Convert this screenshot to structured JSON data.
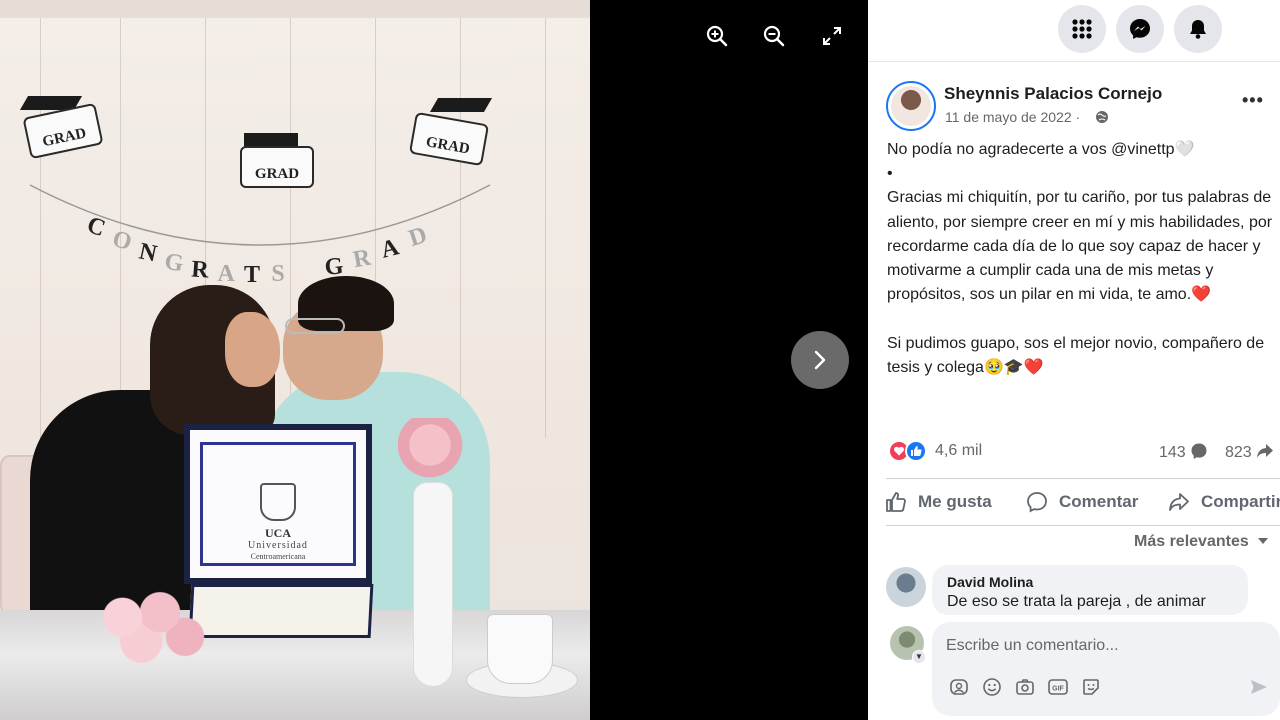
{
  "viewer": {
    "zoom_in_icon": "zoom-in-icon",
    "zoom_out_icon": "zoom-out-icon",
    "fullscreen_icon": "fullscreen-icon",
    "next_icon": "chevron-right-icon"
  },
  "photo": {
    "banner_signs": [
      "GRAD",
      "GRAD",
      "GRAD"
    ],
    "banner_letters": [
      "C",
      "O",
      "N",
      "G",
      "R",
      "A",
      "T",
      "S",
      "G",
      "R",
      "A",
      "D"
    ],
    "diploma": {
      "acronym": "UCA",
      "university": "Universidad",
      "university_line2": "Centroamericana"
    }
  },
  "topbar": {
    "menu_icon": "grid-menu-icon",
    "messenger_icon": "messenger-icon",
    "notifications_icon": "bell-icon"
  },
  "post": {
    "author": "Sheynnis Palacios Cornejo",
    "date": "11 de mayo de 2022 ·",
    "privacy_icon": "globe-icon",
    "more_label": "•••",
    "text": "No podía no agradecerte a vos @vinettp🤍\n•\nGracias mi chiquitín, por tu cariño, por tus palabras de aliento, por siempre creer en mí y mis habilidades, por recordarme cada día de lo que soy capaz de hacer y motivarme a cumplir cada una de mis metas y propósitos, sos un pilar en mi vida, te amo.❤️\n\nSi pudimos guapo, sos el mejor novio, compañero de tesis y colega🥹🎓❤️",
    "reaction_count": "4,6 mil",
    "comment_count": "143",
    "share_count": "823"
  },
  "actions": {
    "like_label": "Me gusta",
    "comment_label": "Comentar",
    "share_label": "Compartir"
  },
  "comments": {
    "sort_label": "Más relevantes",
    "items": [
      {
        "author": "David Molina",
        "text": "De eso se trata la pareja , de animar"
      }
    ],
    "input_placeholder": "Escribe un comentario..."
  },
  "colors": {
    "facebook_blue": "#1877f2",
    "love_red": "#f33e58",
    "panel_bg": "#ffffff",
    "viewer_bg": "#000000"
  }
}
